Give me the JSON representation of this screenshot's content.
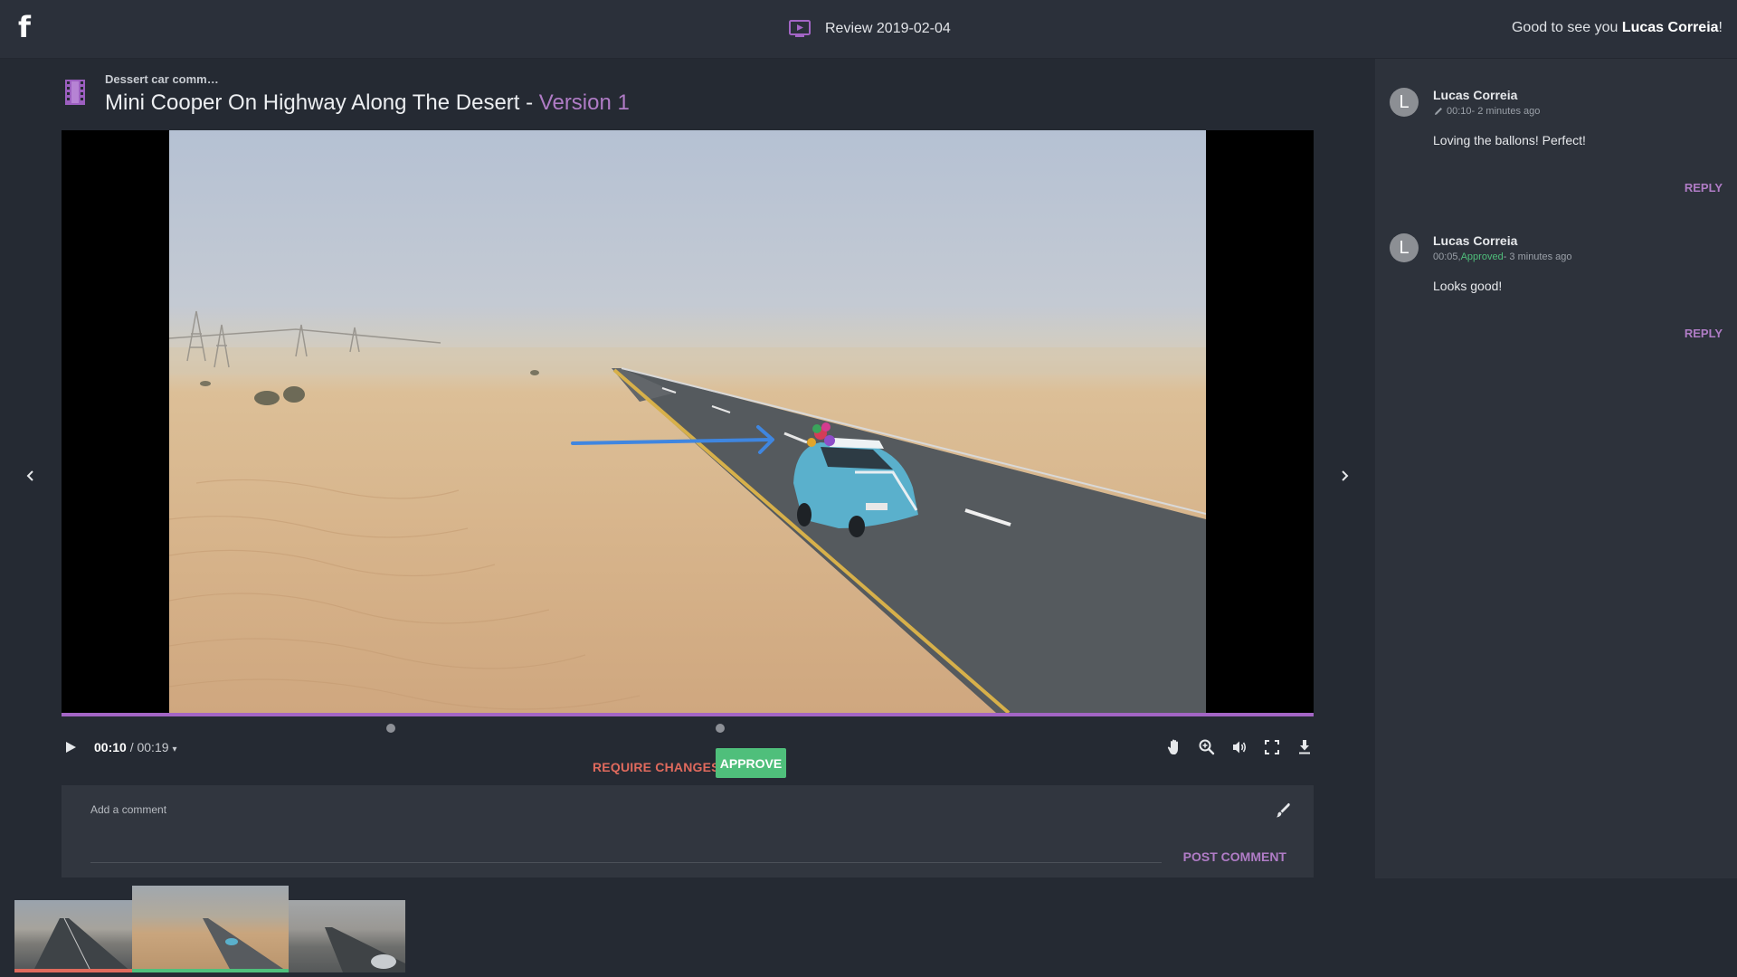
{
  "app": {
    "logo": "f",
    "review_title": "Review 2019-02-04",
    "greeting_prefix": "Good to see you ",
    "greeting_name": "Lucas Correia",
    "greeting_suffix": "!"
  },
  "asset": {
    "subtitle": "Dessert car comm…",
    "title": "Mini Cooper On Highway Along The Desert - ",
    "version": "Version 1"
  },
  "player": {
    "current_time": "00:10",
    "separator": " / ",
    "duration": "00:19",
    "progress_fraction": 1.0,
    "comment_markers_seconds": [
      5,
      10
    ],
    "controls": [
      "pan-hand-icon",
      "zoom-icon",
      "volume-icon",
      "fullscreen-icon",
      "download-icon"
    ]
  },
  "actions": {
    "require_changes": "REQUIRE CHANGES",
    "approve": "APPROVE"
  },
  "comment_box": {
    "placeholder": "Add a comment",
    "post": "POST COMMENT"
  },
  "comments": [
    {
      "avatar": "L",
      "author": "Lucas Correia",
      "meta_time": "00:10",
      "meta_status": "",
      "meta_ago": " - 2 minutes ago",
      "text": "Loving the ballons! Perfect!",
      "reply": "REPLY"
    },
    {
      "avatar": "L",
      "author": "Lucas Correia",
      "meta_time": "00:05, ",
      "meta_status": "Approved",
      "meta_ago": " - 3 minutes ago",
      "text": "Looks good!",
      "reply": "REPLY"
    }
  ],
  "colors": {
    "accent_purple": "#b07cc6",
    "approve_green": "#4fbf7b",
    "require_red": "#e06a5d",
    "annotation_blue": "#3f86e0"
  }
}
